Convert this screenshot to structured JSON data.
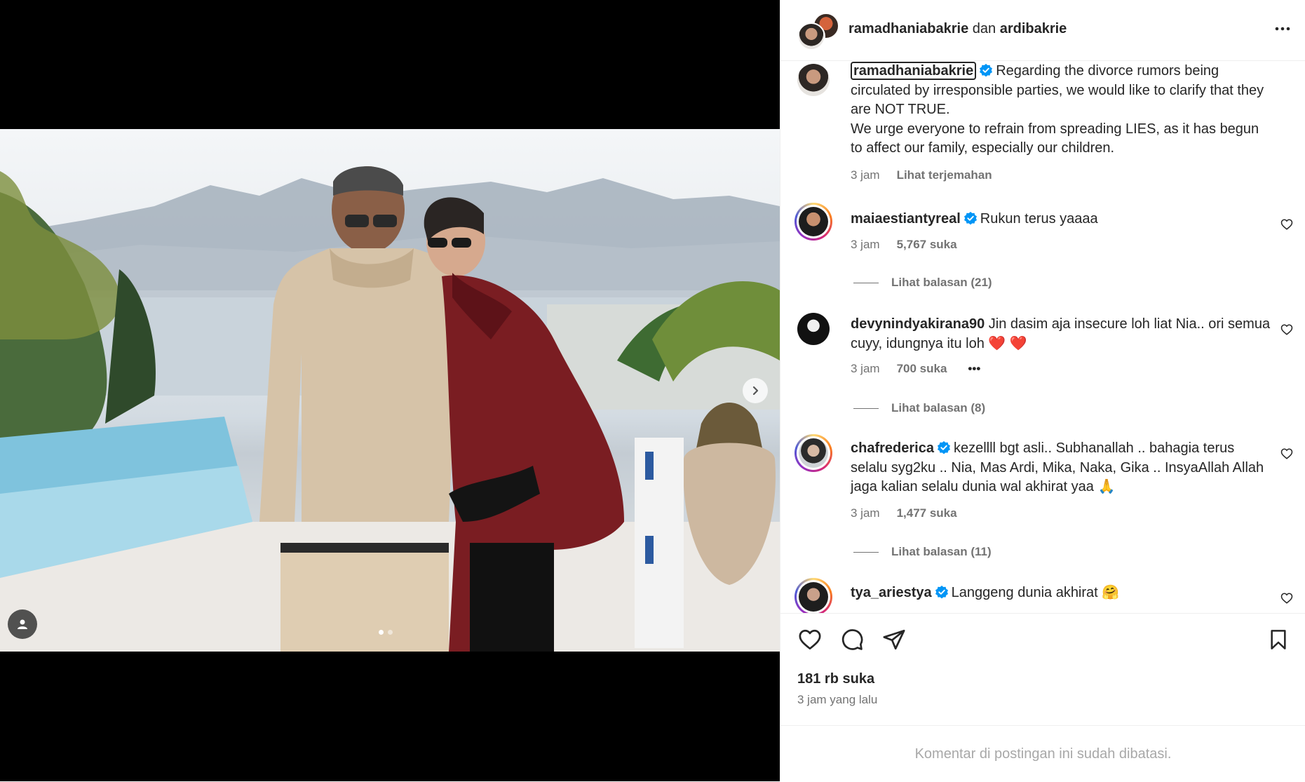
{
  "header": {
    "user1": "ramadhaniabakrie",
    "connector": "dan",
    "user2": "ardibakrie"
  },
  "caption": {
    "username": "ramadhaniabakrie",
    "text": "Regarding the divorce rumors being circulated by irresponsible parties, we would like to clarify that they are NOT TRUE.",
    "text2": "We urge everyone to refrain from spreading LIES, as it has begun to affect our family, especially our children.",
    "time": "3 jam",
    "translate": "Lihat terjemahan"
  },
  "comments": [
    {
      "username": "maiaestiantyreal",
      "verified": true,
      "text": "Rukun terus yaaaa",
      "time": "3 jam",
      "likes": "5,767 suka",
      "replies": "Lihat balasan (21)"
    },
    {
      "username": "devynindyakirana90",
      "verified": false,
      "text": "Jin dasim aja insecure loh liat Nia.. ori semua cuyy, idungnya itu loh",
      "emoji": "❤️ ❤️",
      "time": "3 jam",
      "likes": "700 suka",
      "options": "•••",
      "replies": "Lihat balasan (8)"
    },
    {
      "username": "chafrederica",
      "verified": true,
      "text": "kezellll bgt asli.. Subhanallah .. bahagia terus selalu syg2ku .. Nia, Mas Ardi, Mika, Naka, Gika .. InsyaAllah Allah jaga kalian selalu dunia wal akhirat yaa",
      "emoji": "🙏",
      "time": "3 jam",
      "likes": "1,477 suka",
      "replies": "Lihat balasan (11)"
    },
    {
      "username": "tya_ariestya",
      "verified": true,
      "text": "Langgeng dunia akhirat",
      "emoji": "🤗"
    }
  ],
  "post": {
    "likes": "181 rb suka",
    "time": "3 jam yang lalu",
    "comments_limited": "Komentar di postingan ini sudah dibatasi."
  },
  "carousel": {
    "current": 1,
    "total": 2
  },
  "icons": {
    "more": "more-horizontal-icon",
    "verified": "verified-badge-icon",
    "heart": "heart-outline-icon",
    "comment": "comment-icon",
    "share": "send-icon",
    "save": "bookmark-icon",
    "next": "chevron-right-icon",
    "tag": "user-tag-icon"
  },
  "colors": {
    "verified": "#0095f6",
    "text": "#262626",
    "muted": "#737373",
    "footer": "#a8a8a8"
  }
}
